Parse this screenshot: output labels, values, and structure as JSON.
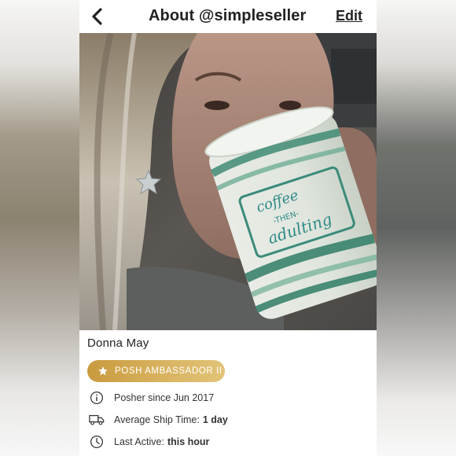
{
  "header": {
    "back_icon": "chevron-left-icon",
    "title": "About @simpleseller",
    "edit_label": "Edit"
  },
  "profile": {
    "photo": "profile-photo-woman-drinking-from-striped-mug",
    "mug_text": [
      "coffee",
      "-THEN-",
      "adulting"
    ],
    "name": "Donna May",
    "badge": {
      "icon": "star-icon",
      "label": "POSH AMBASSADOR II",
      "color": "#d2a94f"
    }
  },
  "details": [
    {
      "icon": "info-icon",
      "label": "Posher since Jun 2017",
      "value": ""
    },
    {
      "icon": "truck-icon",
      "label": "Average Ship Time:",
      "value": "1 day"
    },
    {
      "icon": "clock-icon",
      "label": "Last Active:",
      "value": "this hour"
    }
  ]
}
